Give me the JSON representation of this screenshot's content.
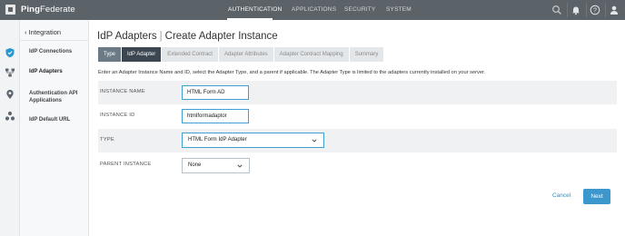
{
  "app": {
    "brand_bold": "Ping",
    "brand_light": "Federate"
  },
  "topnav": {
    "tabs": [
      {
        "label": "AUTHENTICATION",
        "active": true
      },
      {
        "label": "APPLICATIONS",
        "active": false
      },
      {
        "label": "SECURITY",
        "active": false
      },
      {
        "label": "SYSTEM",
        "active": false
      }
    ],
    "icons": [
      "search-icon",
      "bell-icon",
      "help-icon",
      "user-icon"
    ]
  },
  "rail": {
    "icons": [
      "shield-icon",
      "network-icon",
      "location-icon",
      "cluster-icon"
    ]
  },
  "sidebar": {
    "back_label": "Integration",
    "items": [
      {
        "label": "IdP Connections"
      },
      {
        "label": "IdP Adapters"
      },
      {
        "label": "Authentication API Applications"
      },
      {
        "label": "IdP Default URL"
      }
    ]
  },
  "page": {
    "title_section": "IdP Adapters",
    "title_page": "Create Adapter Instance",
    "tabs": [
      {
        "label": "Type",
        "state": "done"
      },
      {
        "label": "IdP Adapter",
        "state": "current"
      },
      {
        "label": "Extended Contract",
        "state": "pending"
      },
      {
        "label": "Adapter Attributes",
        "state": "pending"
      },
      {
        "label": "Adapter Contract Mapping",
        "state": "pending"
      },
      {
        "label": "Summary",
        "state": "pending"
      }
    ],
    "intro": "Enter an Adapter Instance Name and ID, select the Adapter Type, and a parent if applicable. The Adapter Type is limited to the adapters currently installed on your server."
  },
  "form": {
    "instance_name": {
      "label": "INSTANCE NAME",
      "value": "HTML Form AD"
    },
    "instance_id": {
      "label": "INSTANCE ID",
      "value": "htmlformadaptor"
    },
    "type": {
      "label": "TYPE",
      "value": "HTML Form IdP Adapter"
    },
    "parent_instance": {
      "label": "PARENT INSTANCE",
      "value": "None"
    }
  },
  "actions": {
    "cancel_label": "Cancel",
    "next_label": "Next"
  },
  "colors": {
    "topbar": "#5b6268",
    "accent": "#3b97cc",
    "tab_current": "#3c4650",
    "tab_done": "#6c7a86"
  }
}
